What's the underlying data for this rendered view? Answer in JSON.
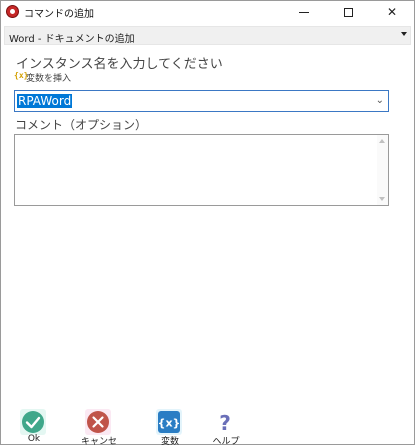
{
  "window": {
    "title": "コマンドの追加"
  },
  "command_select": {
    "value": "Word - ドキュメントの追加"
  },
  "form": {
    "heading": "インスタンス名を入力してください",
    "variable_icon_text": "{x}",
    "insert_variable_label": "変数を挿入",
    "instance_value": "RPAWord",
    "comment_label": "コメント（オプション）",
    "comment_value": ""
  },
  "toolbar": {
    "ok_label": "Ok",
    "cancel_label": "キャンセル",
    "variable_label": "変数",
    "help_label": "ヘルプ"
  },
  "colors": {
    "accent": "#0078d7",
    "ok": "#3fa78a",
    "cancel": "#c0544a",
    "variable": "#2a7dc4",
    "help": "#6a6fb8"
  }
}
